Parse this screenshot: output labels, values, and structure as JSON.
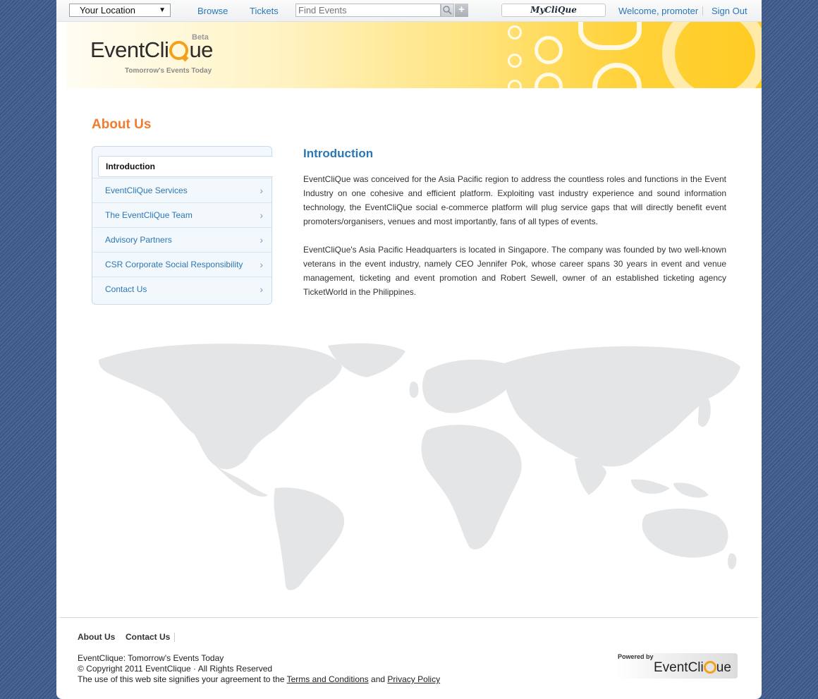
{
  "topbar": {
    "location_label": "Your Location",
    "browse": "Browse",
    "tickets": "Tickets",
    "search_placeholder": "Find Events",
    "myclique": "MyCliQue",
    "welcome": "Welcome, promoter",
    "sign_out": "Sign Out"
  },
  "brand": {
    "name_pre": "EventCli",
    "name_post": "ue",
    "beta": "Beta",
    "tagline": "Tomorrow's Events Today"
  },
  "page_title": "About Us",
  "sidebar": {
    "items": [
      {
        "label": "Introduction"
      },
      {
        "label": "EventCliQue Services"
      },
      {
        "label": "The EventCliQue Team"
      },
      {
        "label": "Advisory Partners"
      },
      {
        "label": "CSR Corporate Social Responsibility"
      },
      {
        "label": "Contact Us"
      }
    ]
  },
  "content": {
    "title": "Introduction",
    "paragraphs": [
      "EventCliQue was conceived for the Asia Pacific region to address the countless roles and functions in the Event Industry on one cohesive and efficient platform. Exploiting vast industry experience and sound information technology, the EventCliQue social e-commerce platform will plug service gaps that will directly benefit event promoters/organisers, venues and most importantly, fans of all types of events.",
      "EventCliQue's Asia Pacific Headquarters is located in Singapore. The company was founded by two well-known veterans in the event industry, namely CEO Jennifer Pok, whose career spans 30 years in event and venue management, ticketing and event promotion and Robert Sewell, owner of an established ticketing agency TicketWorld in the Philippines."
    ]
  },
  "footer": {
    "about": "About Us",
    "contact": "Contact Us",
    "line1": "EventClique: Tomorrow's Events Today",
    "line2": "© Copyright 2011 EventClique · All Rights Reserved",
    "line3_pre": "The use of this web site signifies your agreement to the",
    "terms": "Terms and Conditions",
    "and": "and",
    "privacy": "Privacy Policy",
    "powered_by": "Powered by",
    "powered_name_pre": "EventCli",
    "powered_name_post": "ue"
  },
  "colors": {
    "accent_orange": "#ef7d2f",
    "link_blue": "#2a77b6",
    "banner_yellow": "#ffcc22"
  }
}
